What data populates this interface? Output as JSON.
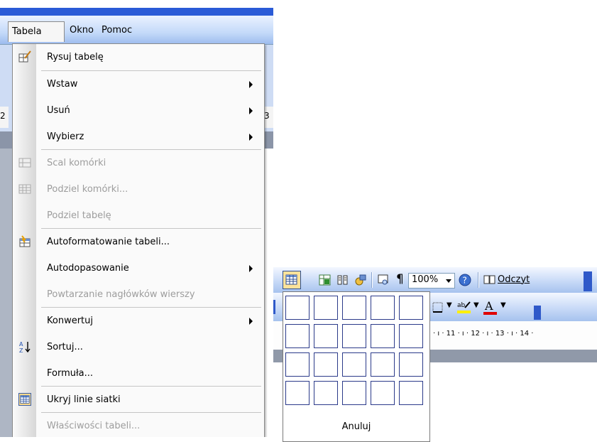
{
  "menubar": {
    "items": [
      "Tabela",
      "Okno",
      "Pomoc"
    ]
  },
  "background_numbers": {
    "left": "2",
    "right": "3"
  },
  "menu": {
    "items": [
      {
        "label": "Rysuj tabelę",
        "icon": "draw-table-icon",
        "disabled": false,
        "submenu": false
      },
      {
        "label": "Wstaw",
        "icon": "",
        "disabled": false,
        "submenu": true
      },
      {
        "label": "Usuń",
        "icon": "",
        "disabled": false,
        "submenu": true
      },
      {
        "label": "Wybierz",
        "icon": "",
        "disabled": false,
        "submenu": true
      },
      {
        "label": "Scal komórki",
        "icon": "merge-cells-icon",
        "disabled": true,
        "submenu": false
      },
      {
        "label": "Podziel komórki...",
        "icon": "split-cells-icon",
        "disabled": true,
        "submenu": false
      },
      {
        "label": "Podziel tabelę",
        "icon": "",
        "disabled": true,
        "submenu": false
      },
      {
        "label": "Autoformatowanie tabeli...",
        "icon": "autoformat-icon",
        "disabled": false,
        "submenu": false
      },
      {
        "label": "Autodopasowanie",
        "icon": "",
        "disabled": false,
        "submenu": true
      },
      {
        "label": "Powtarzanie nagłówków wierszy",
        "icon": "",
        "disabled": true,
        "submenu": false
      },
      {
        "label": "Konwertuj",
        "icon": "",
        "disabled": false,
        "submenu": true
      },
      {
        "label": "Sortuj...",
        "icon": "sort-az-icon",
        "disabled": false,
        "submenu": false
      },
      {
        "label": "Formuła...",
        "icon": "",
        "disabled": false,
        "submenu": false
      },
      {
        "label": "Ukryj linie siatki",
        "icon": "gridlines-icon",
        "disabled": false,
        "submenu": false
      },
      {
        "label": "Właściwości tabeli...",
        "icon": "",
        "disabled": true,
        "submenu": false
      }
    ]
  },
  "toolbar": {
    "zoom": "100%",
    "read_label": "Odczyt",
    "ruler_text": "· ı · 11 · ı · 12 · ı · 13 · ı · 14 ·"
  },
  "picker": {
    "rows": 4,
    "cols": 5,
    "cancel_label": "Anuluj"
  },
  "colors": {
    "menu_bg": "#fafafa",
    "toolbar_blue": "#c8daf7",
    "grid_border": "#2b3a8a"
  }
}
